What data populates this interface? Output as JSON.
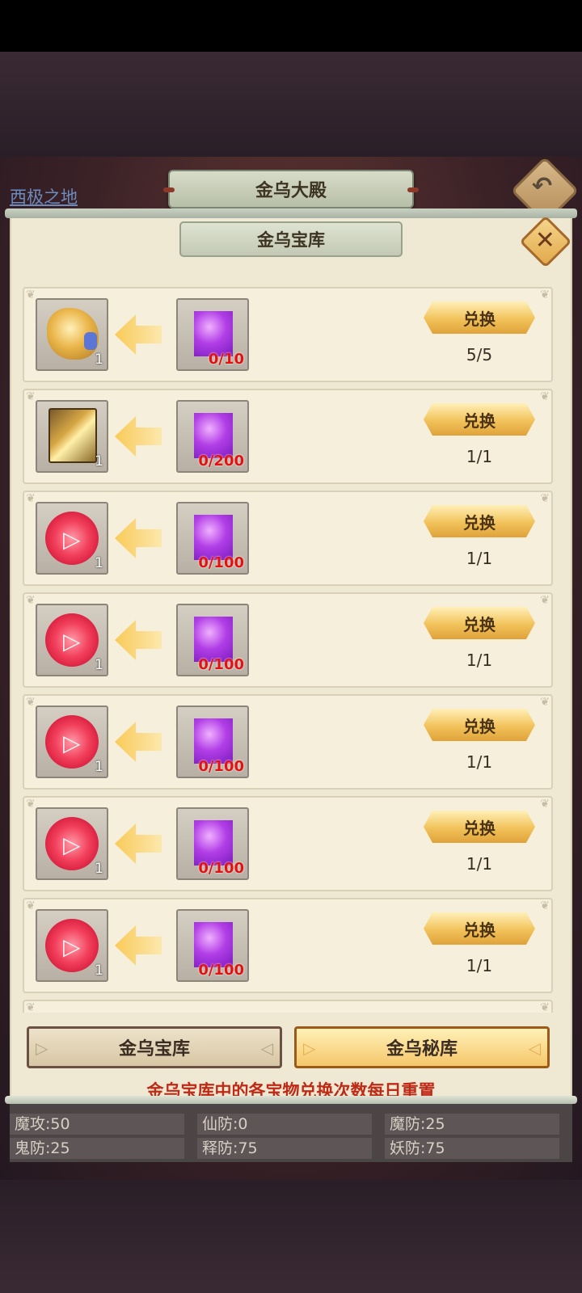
{
  "header": {
    "region_link": "西极之地",
    "hall_title": "金乌大殿",
    "back_icon": "back-arrow-icon"
  },
  "panel": {
    "title": "金乌宝库",
    "close_icon": "close-icon"
  },
  "rows": [
    {
      "reward_icon": "golden-relic-icon",
      "reward_count": "1",
      "cost_icon": "purple-gem-icon",
      "cost_progress": "0/10",
      "button": "兑换",
      "limit": "5/5"
    },
    {
      "reward_icon": "golden-book-icon",
      "reward_count": "1",
      "cost_icon": "purple-gem-icon",
      "cost_progress": "0/200",
      "button": "兑换",
      "limit": "1/1"
    },
    {
      "reward_icon": "red-orb-icon",
      "reward_count": "1",
      "cost_icon": "purple-gem-icon",
      "cost_progress": "0/100",
      "button": "兑换",
      "limit": "1/1"
    },
    {
      "reward_icon": "red-orb-icon",
      "reward_count": "1",
      "cost_icon": "purple-gem-icon",
      "cost_progress": "0/100",
      "button": "兑换",
      "limit": "1/1"
    },
    {
      "reward_icon": "red-orb-icon",
      "reward_count": "1",
      "cost_icon": "purple-gem-icon",
      "cost_progress": "0/100",
      "button": "兑换",
      "limit": "1/1"
    },
    {
      "reward_icon": "red-orb-icon",
      "reward_count": "1",
      "cost_icon": "purple-gem-icon",
      "cost_progress": "0/100",
      "button": "兑换",
      "limit": "1/1"
    },
    {
      "reward_icon": "red-orb-icon",
      "reward_count": "1",
      "cost_icon": "purple-gem-icon",
      "cost_progress": "0/100",
      "button": "兑换",
      "limit": "1/1"
    }
  ],
  "tabs": {
    "left": "金乌宝库",
    "right": "金乌秘库"
  },
  "notice": "金乌宝库中的各宝物兑换次数每日重置",
  "stats": {
    "row1": [
      "魔攻:50",
      "仙防:0",
      "魔防:25"
    ],
    "row2": [
      "鬼防:25",
      "释防:75",
      "妖防:75"
    ]
  }
}
